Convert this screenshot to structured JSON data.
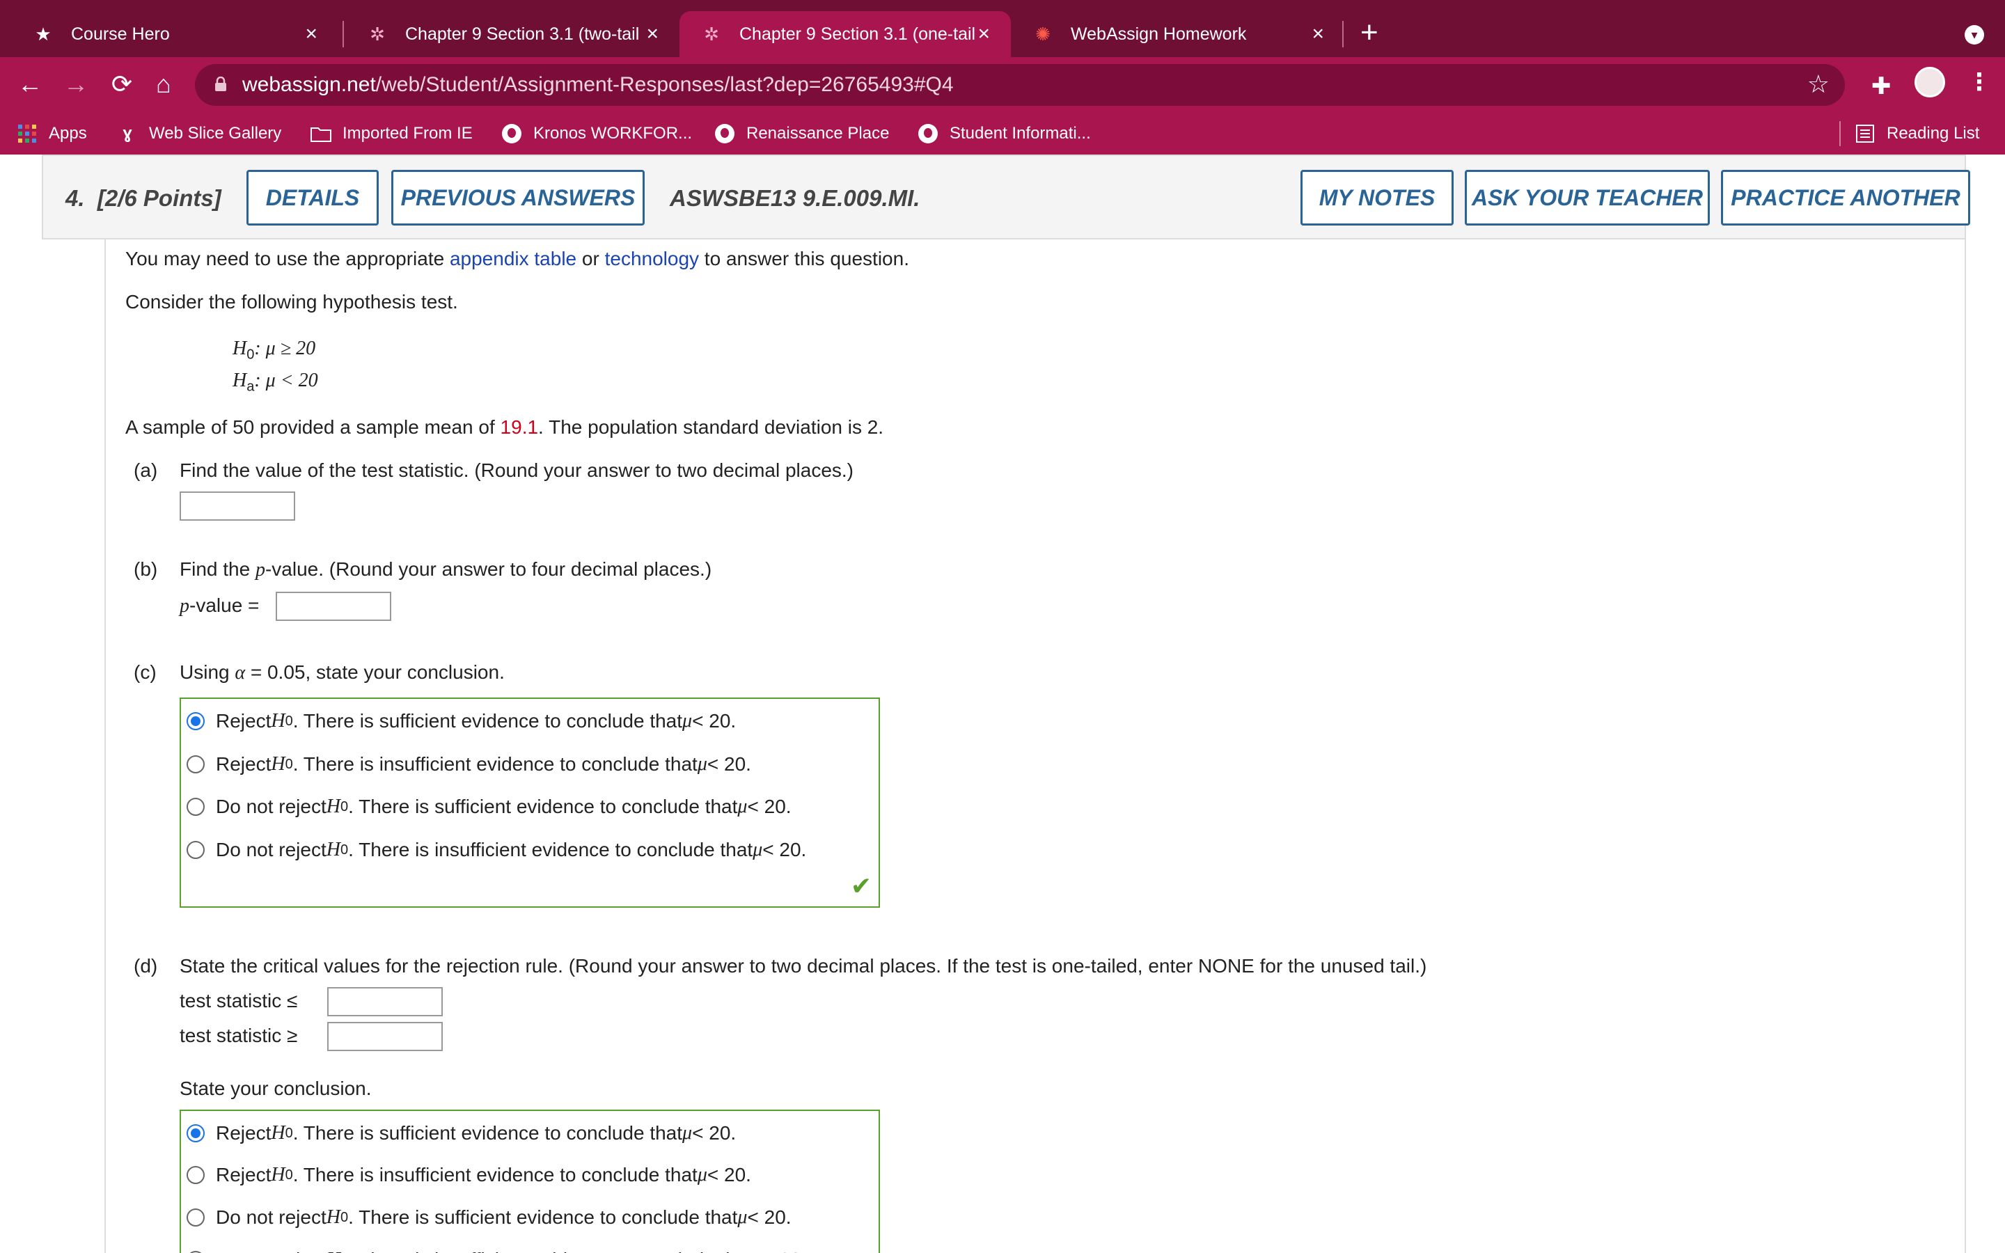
{
  "browser": {
    "tabs": [
      {
        "title": "Course Hero",
        "icon": "star-icon",
        "active": false
      },
      {
        "title": "Chapter 9 Section 3.1 (two-tail",
        "icon": "calculator-icon",
        "active": false
      },
      {
        "title": "Chapter 9 Section 3.1 (one-tail",
        "icon": "calculator-icon",
        "active": true
      },
      {
        "title": "WebAssign Homework",
        "icon": "webassign-icon",
        "active": false
      }
    ],
    "tab_close": "×",
    "new_tab": "+",
    "url_host": "webassign.net",
    "url_path": "/web/Student/Assignment-Responses/last?dep=26765493#Q4",
    "bookmarks": [
      {
        "label": "Apps",
        "icon": "apps-grid-icon"
      },
      {
        "label": "Web Slice Gallery",
        "icon": "web-slice-icon"
      },
      {
        "label": "Imported From IE",
        "icon": "folder-icon"
      },
      {
        "label": "Kronos WORKFOR...",
        "icon": "globe-icon"
      },
      {
        "label": "Renaissance Place",
        "icon": "globe-icon"
      },
      {
        "label": "Student Informati...",
        "icon": "globe-icon"
      }
    ],
    "reading_list": "Reading List"
  },
  "question": {
    "number": "4.",
    "points": "[2/6 Points]",
    "buttons": {
      "details": "DETAILS",
      "previous_answers": "PREVIOUS ANSWERS",
      "my_notes": "MY NOTES",
      "ask_teacher": "ASK YOUR TEACHER",
      "practice_another": "PRACTICE ANOTHER"
    },
    "code": "ASWSBE13 9.E.009.MI.",
    "intro_pre": "You may need to use the appropriate ",
    "intro_link1": "appendix table",
    "intro_mid": " or ",
    "intro_link2": "technology",
    "intro_post": " to answer this question.",
    "consider": "Consider the following hypothesis test.",
    "h0_sym": "H",
    "h0_sub": "0",
    "h0_rest": ": μ ≥ 20",
    "ha_sym": "H",
    "ha_sub": "a",
    "ha_rest": ": μ < 20",
    "sample_pre": "A sample of 50 provided a sample mean of ",
    "sample_mean": "19.1",
    "sample_post": ". The population standard deviation is 2.",
    "part_a_label": "(a)",
    "part_a_text": "Find the value of the test statistic. (Round your answer to two decimal places.)",
    "part_b_label": "(b)",
    "part_b_pre": "Find the ",
    "part_b_p": "p",
    "part_b_post": "-value. (Round your answer to four decimal places.)",
    "pvalue_label_p": "p",
    "pvalue_label_rest": "-value =",
    "part_c_label": "(c)",
    "part_c_pre": "Using ",
    "part_c_alpha": "α",
    "part_c_post": " = 0.05, state your conclusion.",
    "choices": [
      {
        "pre": "Reject ",
        "post": ". There is sufficient evidence to conclude that ",
        "tail": " < 20.",
        "checked": true
      },
      {
        "pre": "Reject ",
        "post": ". There is insufficient evidence to conclude that ",
        "tail": " < 20.",
        "checked": false
      },
      {
        "pre": "Do not reject ",
        "post": ". There is sufficient evidence to conclude that ",
        "tail": " < 20.",
        "checked": false
      },
      {
        "pre": "Do not reject ",
        "post": ". There is insufficient evidence to conclude that ",
        "tail": " < 20.",
        "checked": false
      }
    ],
    "h_sym": "H",
    "h_sub": "0",
    "mu": "μ",
    "check_mark": "✔",
    "part_d_label": "(d)",
    "part_d_text": "State the critical values for the rejection rule. (Round your answer to two decimal places. If the test is one-tailed, enter NONE for the unused tail.)",
    "ts_le": "test statistic  ≤",
    "ts_ge": "test statistic  ≥",
    "state_conclusion": "State your conclusion."
  }
}
